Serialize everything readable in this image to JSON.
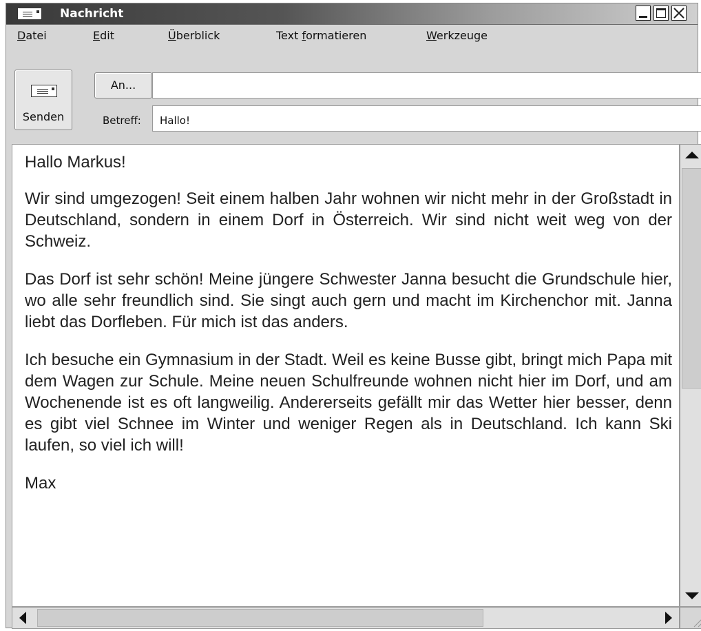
{
  "window": {
    "title": "Nachricht",
    "icon": "envelope-icon"
  },
  "menu": {
    "items": [
      {
        "label_first": "D",
        "label_rest": "atei"
      },
      {
        "label_first": "E",
        "label_rest": "dit"
      },
      {
        "label_first": "Ü",
        "label_rest": "berblick"
      },
      {
        "label_pre": "Text ",
        "label_first": "f",
        "label_rest": "ormatieren"
      },
      {
        "label_first": "W",
        "label_rest": "erkzeuge"
      }
    ]
  },
  "compose": {
    "send_label": "Senden",
    "to_button": "An...",
    "to_value": "",
    "subject_label": "Betreff:",
    "subject_value": "Hallo!"
  },
  "message": {
    "paragraphs": [
      "Hallo Markus!",
      "Wir sind umgezogen! Seit einem halben Jahr wohnen wir nicht mehr in der Großstadt in Deutschland, sondern in einem Dorf in Österreich. Wir sind nicht weit weg von der Schweiz.",
      "Das Dorf ist sehr schön! Meine jüngere Schwester Janna besucht die Grundschule hier, wo alle sehr freundlich sind. Sie singt auch gern und macht im Kirchenchor mit. Janna liebt das Dorfleben. Für mich ist das anders.",
      "Ich besuche ein Gymnasium in der Stadt. Weil es keine Busse gibt, bringt mich Papa mit dem Wagen zur Schule. Meine neuen Schulfreunde wohnen nicht hier im Dorf, und am Wochenende ist es oft langweilig. Andererseits gefällt mir das Wetter hier besser, denn es gibt viel Schnee im Winter und weniger Regen als in Deutschland. Ich kann Ski laufen, so viel ich will!",
      "Max"
    ]
  }
}
